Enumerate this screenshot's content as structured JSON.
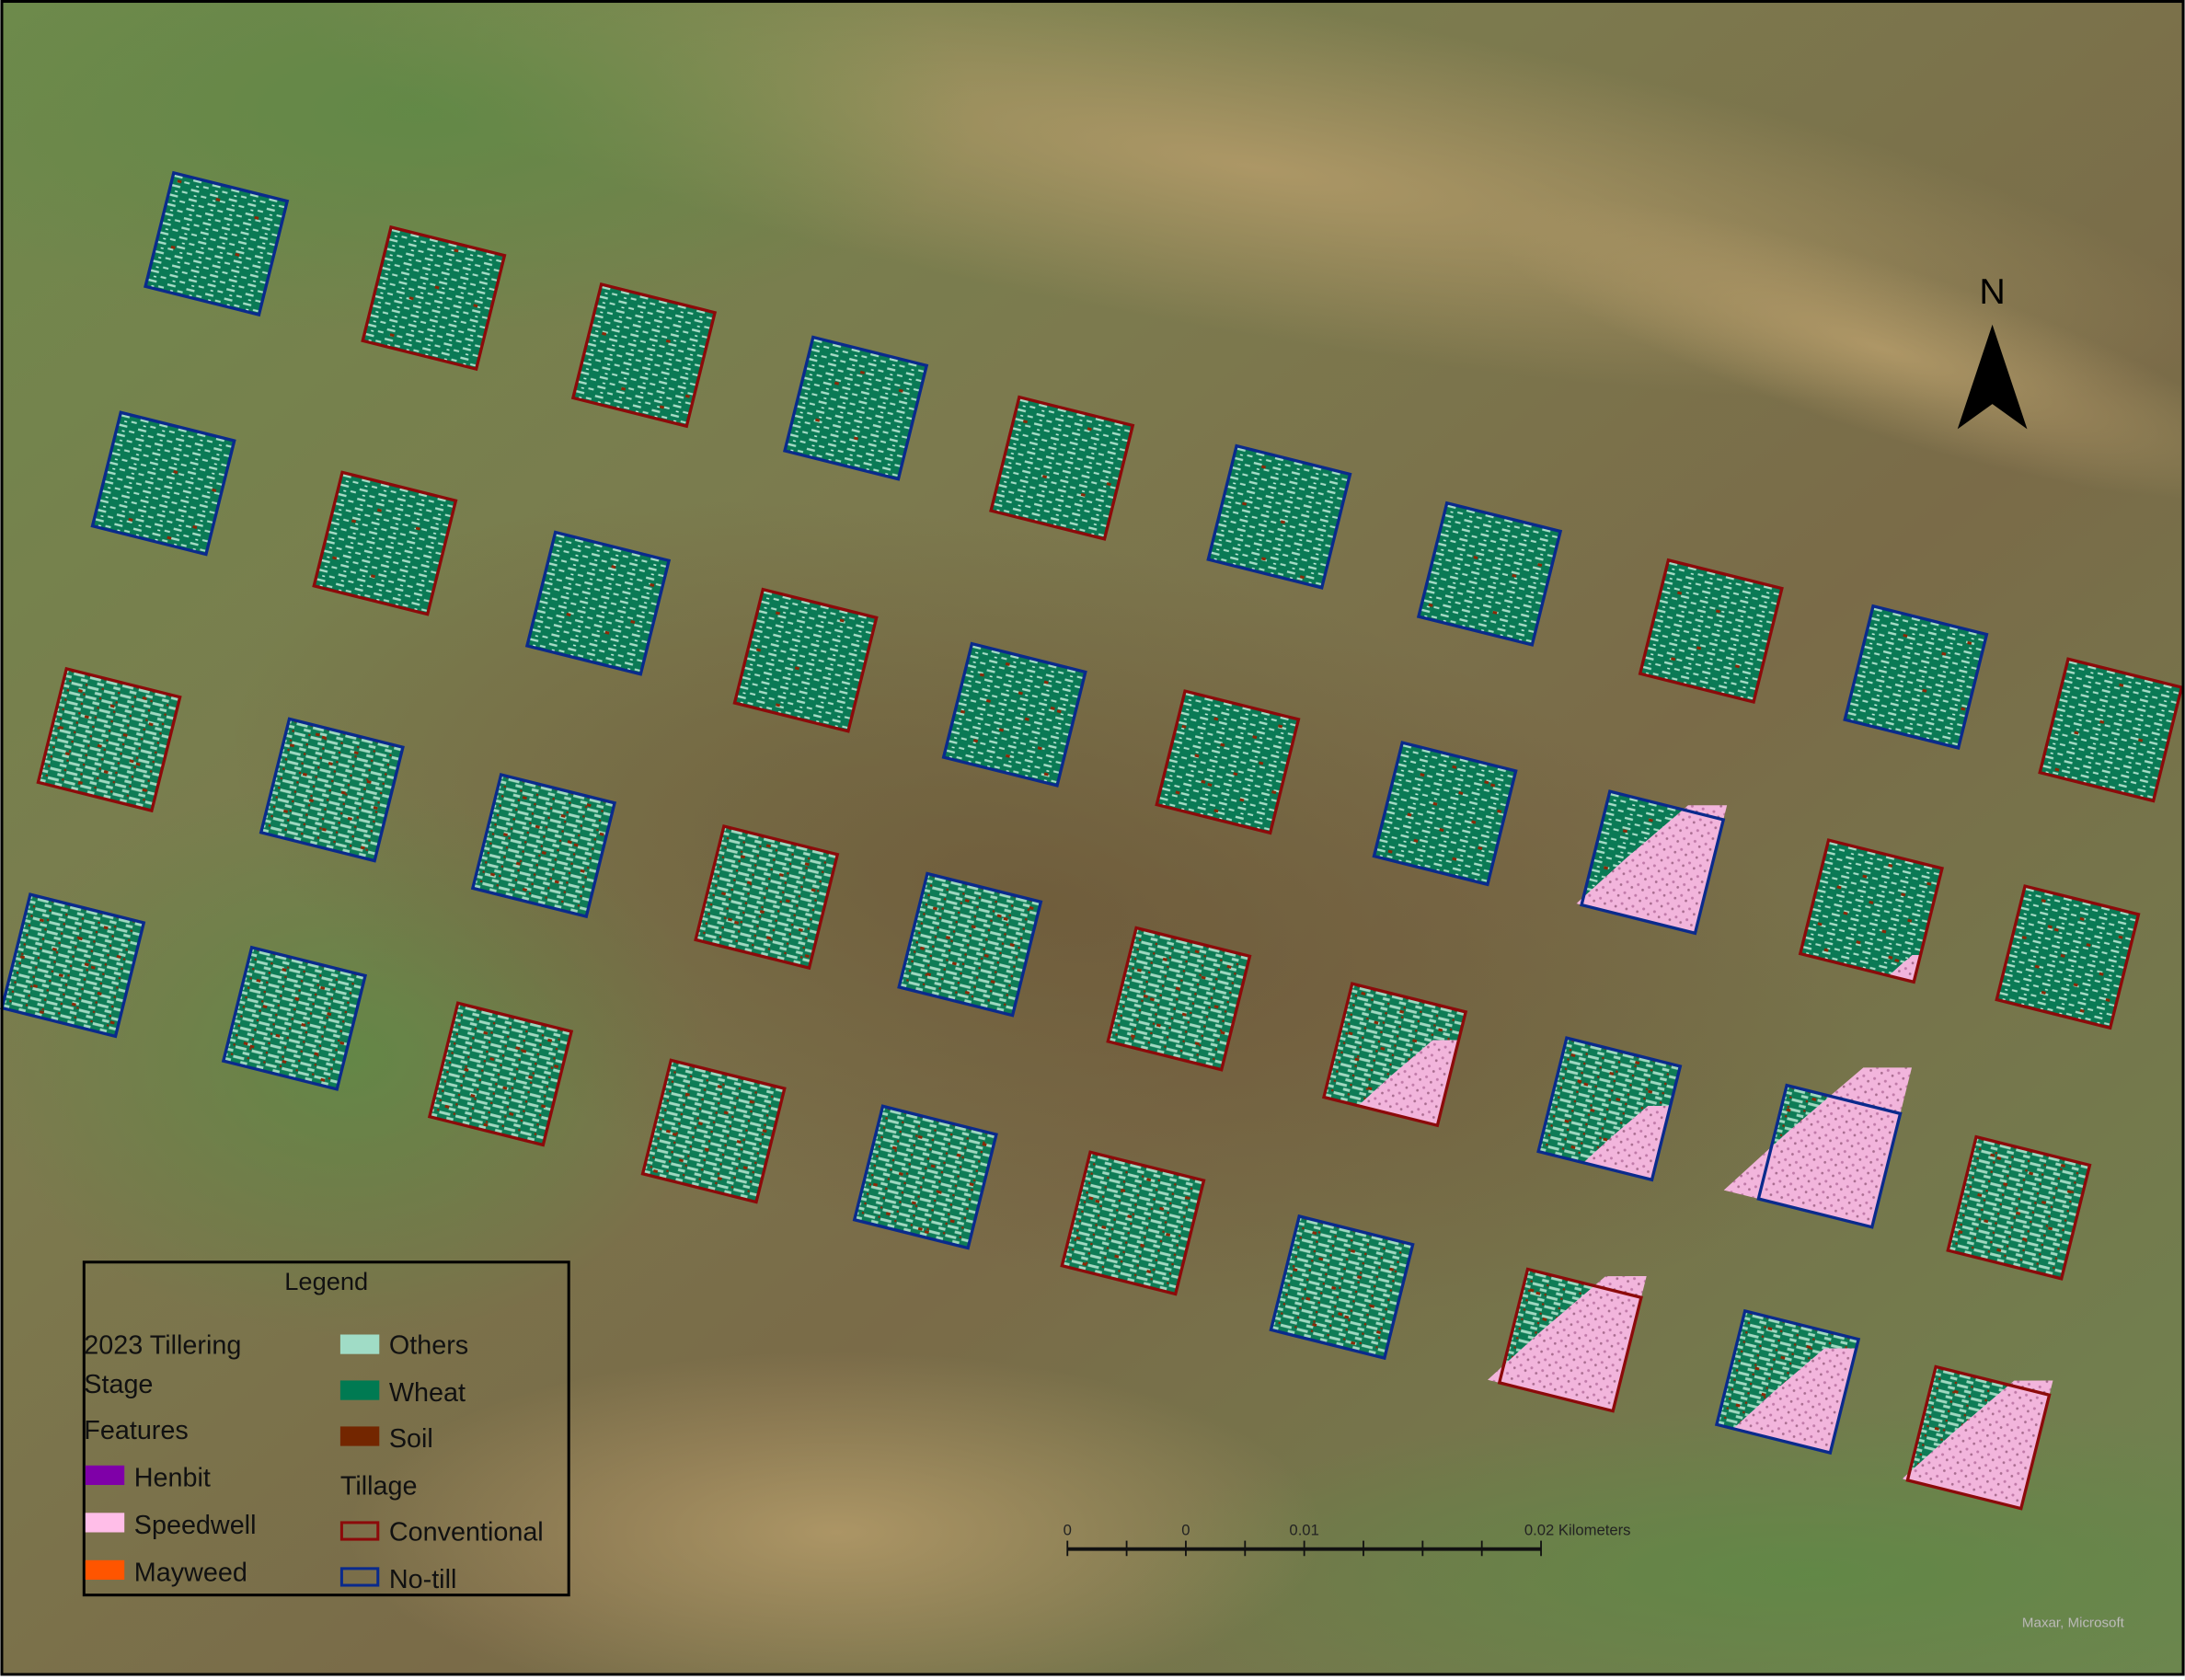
{
  "map": {
    "north_label": "N",
    "attribution": "Maxar, Microsoft"
  },
  "legend": {
    "title": "Legend",
    "layer_title_line1": "2023 Tillering",
    "layer_title_line2": "Stage",
    "features_heading": "Features",
    "features": [
      {
        "label": "Henbit",
        "color": "#7f00a8"
      },
      {
        "label": "Speedwell",
        "color": "#ffbee8"
      },
      {
        "label": "Mayweed",
        "color": "#ff5500"
      }
    ],
    "classes": [
      {
        "label": "Others",
        "color": "#a0dcc6"
      },
      {
        "label": "Wheat",
        "color": "#007a52"
      },
      {
        "label": "Soil",
        "color": "#732600"
      }
    ],
    "tillage_heading": "Tillage",
    "tillage": [
      {
        "label": "Conventional",
        "color": "#8c0a0a"
      },
      {
        "label": "No-till",
        "color": "#0a2a8c"
      }
    ]
  },
  "scale_bar": {
    "labels": [
      "0",
      "0",
      "0.01",
      "0.02 Kilometers"
    ]
  },
  "plots": [
    {
      "tillage": "No-till",
      "speedwell": 0
    },
    {
      "tillage": "Conventional",
      "speedwell": 0
    },
    {
      "tillage": "Conventional",
      "speedwell": 0
    },
    {
      "tillage": "No-till",
      "speedwell": 0
    },
    {
      "tillage": "Conventional",
      "speedwell": 0
    },
    {
      "tillage": "No-till",
      "speedwell": 0
    },
    {
      "tillage": "No-till",
      "speedwell": 0
    },
    {
      "tillage": "Conventional",
      "speedwell": 0
    },
    {
      "tillage": "No-till",
      "speedwell": 0
    },
    {
      "tillage": "Conventional",
      "speedwell": 0
    },
    {
      "tillage": "No-till",
      "speedwell": 0
    },
    {
      "tillage": "Conventional",
      "speedwell": 0
    },
    {
      "tillage": "No-till",
      "speedwell": 0
    },
    {
      "tillage": "Conventional",
      "speedwell": 0
    },
    {
      "tillage": "No-till",
      "speedwell": 0
    },
    {
      "tillage": "Conventional",
      "speedwell": 0
    },
    {
      "tillage": "No-till",
      "speedwell": 0
    },
    {
      "tillage": "No-till",
      "speedwell": 0.45
    },
    {
      "tillage": "Conventional",
      "speedwell": 0.02
    },
    {
      "tillage": "Conventional",
      "speedwell": 0
    },
    {
      "tillage": "Conventional",
      "speedwell": 0
    },
    {
      "tillage": "No-till",
      "speedwell": 0
    },
    {
      "tillage": "No-till",
      "speedwell": 0
    },
    {
      "tillage": "Conventional",
      "speedwell": 0
    },
    {
      "tillage": "No-till",
      "speedwell": 0
    },
    {
      "tillage": "Conventional",
      "speedwell": 0
    },
    {
      "tillage": "Conventional",
      "speedwell": 0.2
    },
    {
      "tillage": "No-till",
      "speedwell": 0.15
    },
    {
      "tillage": "No-till",
      "speedwell": 0.7
    },
    {
      "tillage": "Conventional",
      "speedwell": 0
    },
    {
      "tillage": "No-till",
      "speedwell": 0
    },
    {
      "tillage": "No-till",
      "speedwell": 0
    },
    {
      "tillage": "Conventional",
      "speedwell": 0
    },
    {
      "tillage": "Conventional",
      "speedwell": 0
    },
    {
      "tillage": "No-till",
      "speedwell": 0
    },
    {
      "tillage": "Conventional",
      "speedwell": 0
    },
    {
      "tillage": "No-till",
      "speedwell": 0
    },
    {
      "tillage": "Conventional",
      "speedwell": 0.5
    },
    {
      "tillage": "No-till",
      "speedwell": 0.3
    },
    {
      "tillage": "Conventional",
      "speedwell": 0.45
    }
  ]
}
